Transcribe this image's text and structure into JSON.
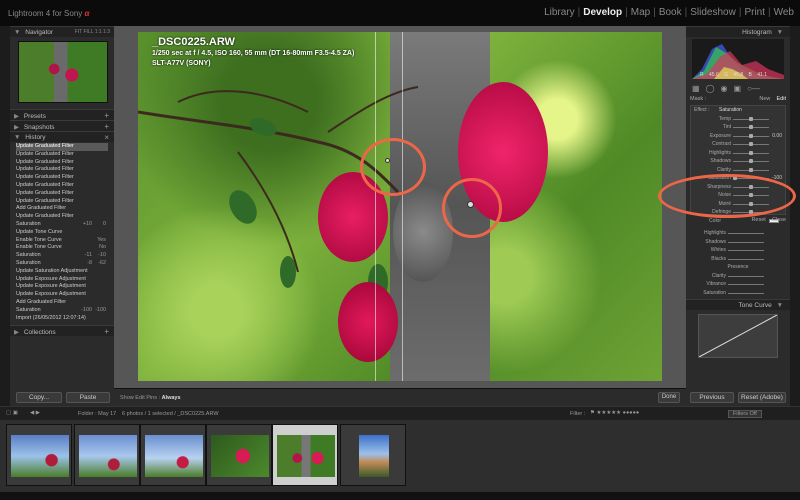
{
  "app": {
    "title_prefix": "Lightroom 4 for Sony",
    "brand_mark": "α"
  },
  "modules": [
    "Library",
    "Develop",
    "Map",
    "Book",
    "Slideshow",
    "Print",
    "Web"
  ],
  "active_module": "Develop",
  "left_panel": {
    "navigator": {
      "title": "Navigator",
      "tabs": "FIT FILL 1:1 1:3"
    },
    "presets": {
      "title": "Presets"
    },
    "snapshots": {
      "title": "Snapshots"
    },
    "history": {
      "title": "History",
      "items": [
        {
          "label": "Update Graduated Filter",
          "v1": "",
          "v2": ""
        },
        {
          "label": "Update Graduated Filter",
          "v1": "",
          "v2": ""
        },
        {
          "label": "Update Graduated Filter",
          "v1": "",
          "v2": ""
        },
        {
          "label": "Update Graduated Filter",
          "v1": "",
          "v2": ""
        },
        {
          "label": "Update Graduated Filter",
          "v1": "",
          "v2": ""
        },
        {
          "label": "Update Graduated Filter",
          "v1": "",
          "v2": ""
        },
        {
          "label": "Update Graduated Filter",
          "v1": "",
          "v2": ""
        },
        {
          "label": "Update Graduated Filter",
          "v1": "",
          "v2": ""
        },
        {
          "label": "Add Graduated Filter",
          "v1": "",
          "v2": ""
        },
        {
          "label": "Update Graduated Filter",
          "v1": "",
          "v2": ""
        },
        {
          "label": "Saturation",
          "v1": "+10",
          "v2": "0"
        },
        {
          "label": "Update Tone Curve",
          "v1": "",
          "v2": ""
        },
        {
          "label": "Enable Tone Curve",
          "v1": "",
          "v2": "Yes"
        },
        {
          "label": "Enable Tone Curve",
          "v1": "",
          "v2": "No"
        },
        {
          "label": "Saturation",
          "v1": "-11",
          "v2": "-10"
        },
        {
          "label": "Saturation",
          "v1": "-8",
          "v2": "-62"
        },
        {
          "label": "Update Saturation Adjustment",
          "v1": "",
          "v2": ""
        },
        {
          "label": "Update Exposure Adjustment",
          "v1": "",
          "v2": ""
        },
        {
          "label": "Update Exposure Adjustment",
          "v1": "",
          "v2": ""
        },
        {
          "label": "Update Exposure Adjustment",
          "v1": "",
          "v2": ""
        },
        {
          "label": "Add Graduated Filter",
          "v1": "",
          "v2": ""
        },
        {
          "label": "Saturation",
          "v1": "-100",
          "v2": "-100"
        },
        {
          "label": "Import (26/05/2012 12:07:14)",
          "v1": "",
          "v2": ""
        }
      ],
      "selected_index": 0
    },
    "collections": {
      "title": "Collections"
    },
    "copy_label": "Copy...",
    "paste_label": "Paste"
  },
  "photo": {
    "filename": "_DSC0225.ARW",
    "meta": "1/250 sec at f / 4.5, ISO 160, 55 mm (DT 16-80mm F3.5-4.5 ZA)",
    "camera": "SLT-A77V (SONY)"
  },
  "toolbar": {
    "show_pins_label": "Show Edit Pins :",
    "show_pins_value": "Always",
    "done_label": "Done"
  },
  "right_panel": {
    "histogram": {
      "title": "Histogram",
      "r": "R 45.6",
      "g": "G 45.8",
      "b": "B 41.1"
    },
    "mask": {
      "label": "Mask :",
      "new": "New",
      "edit": "Edit"
    },
    "effect": {
      "label": "Effect :",
      "value": "Saturation"
    },
    "effects": [
      {
        "label": "Temp",
        "val": "",
        "knob": 0.5
      },
      {
        "label": "Tint",
        "val": "",
        "knob": 0.5
      },
      {
        "label": "Exposure",
        "val": "0.00",
        "knob": 0.5
      },
      {
        "label": "Contrast",
        "val": "",
        "knob": 0.5
      },
      {
        "label": "Highlights",
        "val": "",
        "knob": 0.5
      },
      {
        "label": "Shadows",
        "val": "",
        "knob": 0.5
      },
      {
        "label": "Clarity",
        "val": "",
        "knob": 0.5
      },
      {
        "label": "Saturation",
        "val": "-100",
        "knob": 0.0
      },
      {
        "label": "Sharpness",
        "val": "",
        "knob": 0.5
      },
      {
        "label": "Noise",
        "val": "",
        "knob": 0.5
      },
      {
        "label": "Moiré",
        "val": "",
        "knob": 0.5
      },
      {
        "label": "Defringe",
        "val": "",
        "knob": 0.5
      }
    ],
    "color_label": "Color",
    "reset_label": "Reset",
    "close_label": "Close",
    "basic_rows": [
      "Highlights",
      "Shadows",
      "Whites",
      "Blacks"
    ],
    "presence_label": "Presence",
    "presence_rows": [
      "Clarity",
      "Vibrance",
      "Saturation"
    ],
    "tone_curve_title": "Tone Curve",
    "previous_label": "Previous",
    "reset_adobe_label": "Reset (Adobe)"
  },
  "filmstrip": {
    "folder": "Folder : May 17",
    "count": "6 photos / 1 selected / _DSC0225.ARW",
    "filter_label": "Filter :",
    "filters_off": "Filters Off",
    "selected_index": 4
  }
}
